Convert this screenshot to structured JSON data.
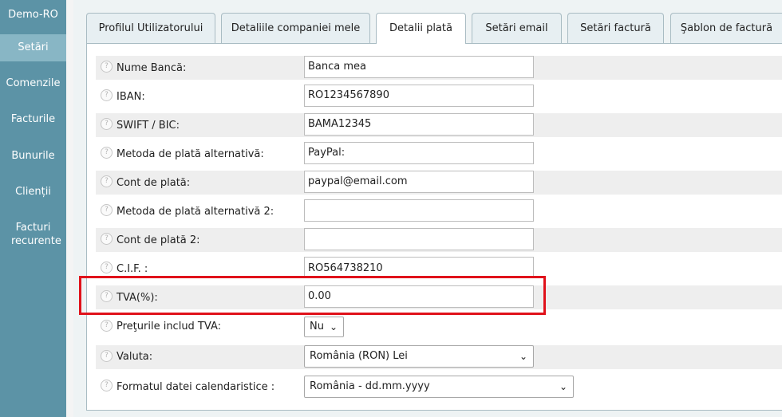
{
  "sidebar": {
    "brand": "Demo-RO",
    "items": [
      {
        "label": "Setări",
        "active": true
      },
      {
        "label": "Comenzile"
      },
      {
        "label": "Facturile"
      },
      {
        "label": "Bunurile"
      },
      {
        "label": "Clienții"
      },
      {
        "label": "Facturi recurente"
      }
    ]
  },
  "tabs": [
    {
      "label": "Profilul Utilizatorului"
    },
    {
      "label": "Detaliile companiei mele"
    },
    {
      "label": "Detalii plată",
      "active": true
    },
    {
      "label": "Setări email"
    },
    {
      "label": "Setări factură"
    },
    {
      "label": "Şablon de factură"
    }
  ],
  "form": {
    "bank_name": {
      "label": "Nume Bancă:",
      "value": "Banca mea"
    },
    "iban": {
      "label": "IBAN:",
      "value": "RO1234567890"
    },
    "swift": {
      "label": "SWIFT / BIC:",
      "value": "BAMA12345"
    },
    "alt_method": {
      "label": "Metoda de plată alternativă:",
      "value": "PayPal:"
    },
    "payment_account": {
      "label": "Cont de plată:",
      "value": "paypal@email.com"
    },
    "alt_method_2": {
      "label": "Metoda de plată alternativă 2:",
      "value": ""
    },
    "payment_account_2": {
      "label": "Cont de plată 2:",
      "value": ""
    },
    "cif": {
      "label": "C.I.F. :",
      "value": "RO564738210"
    },
    "vat": {
      "label": "TVA(%):",
      "value": "0.00"
    },
    "prices_include_vat": {
      "label": "Preţurile includ TVA:",
      "value": "Nu"
    },
    "currency": {
      "label": "Valuta:",
      "value": "România (RON) Lei"
    },
    "date_format": {
      "label": "Formatul datei calendaristice :",
      "value": "România - dd.mm.yyyy"
    }
  },
  "icons": {
    "help": "question-circle-icon",
    "dropdown": "chevron-down-icon"
  },
  "colors": {
    "sidebar": "#5c93a6",
    "sidebar_active": "#88b6c5",
    "highlight": "#e0121b"
  }
}
